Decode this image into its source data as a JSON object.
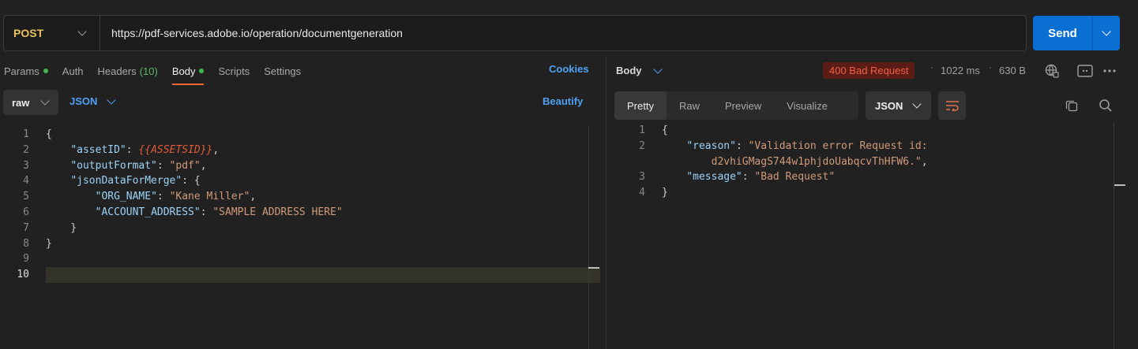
{
  "request": {
    "method": "POST",
    "url": "https://pdf-services.adobe.io/operation/documentgeneration",
    "send_label": "Send"
  },
  "tabs": {
    "params": "Params",
    "auth": "Auth",
    "headers": "Headers",
    "headers_count": "(10)",
    "body": "Body",
    "scripts": "Scripts",
    "settings": "Settings",
    "cookies": "Cookies"
  },
  "body_options": {
    "mode": "raw",
    "format": "JSON",
    "beautify": "Beautify"
  },
  "request_body": {
    "line_numbers": [
      "1",
      "2",
      "3",
      "4",
      "5",
      "6",
      "7",
      "8",
      "9",
      "10"
    ],
    "assetID_key": "\"assetID\"",
    "assetID_val": "{{ASSETSID}}",
    "outputFormat_key": "\"outputFormat\"",
    "outputFormat_val": "\"pdf\"",
    "jsonData_key": "\"jsonDataForMerge\"",
    "org_key": "\"ORG_NAME\"",
    "org_val": "\"Kane Miller\"",
    "addr_key": "\"ACCOUNT_ADDRESS\"",
    "addr_val": "\"SAMPLE ADDRESS HERE\""
  },
  "response": {
    "body_label": "Body",
    "status": "400 Bad Request",
    "time": "1022 ms",
    "size": "630 B",
    "status_color": "#f06048",
    "tabs": [
      "Pretty",
      "Raw",
      "Preview",
      "Visualize"
    ],
    "format": "JSON",
    "line_numbers": [
      "1",
      "2",
      "3",
      "4"
    ],
    "reason_key": "\"reason\"",
    "reason_val_1": "\"Validation error Request id:",
    "reason_val_2": "d2vhiGMagS744w1phjdoUabqcvThHFW6.\"",
    "message_key": "\"message\"",
    "message_val": "\"Bad Request\""
  },
  "colors": {
    "accent": "#0a6fd3",
    "link": "#4ea1f3",
    "active_tab_underline": "#f06a31",
    "method": "#e6c35b"
  }
}
